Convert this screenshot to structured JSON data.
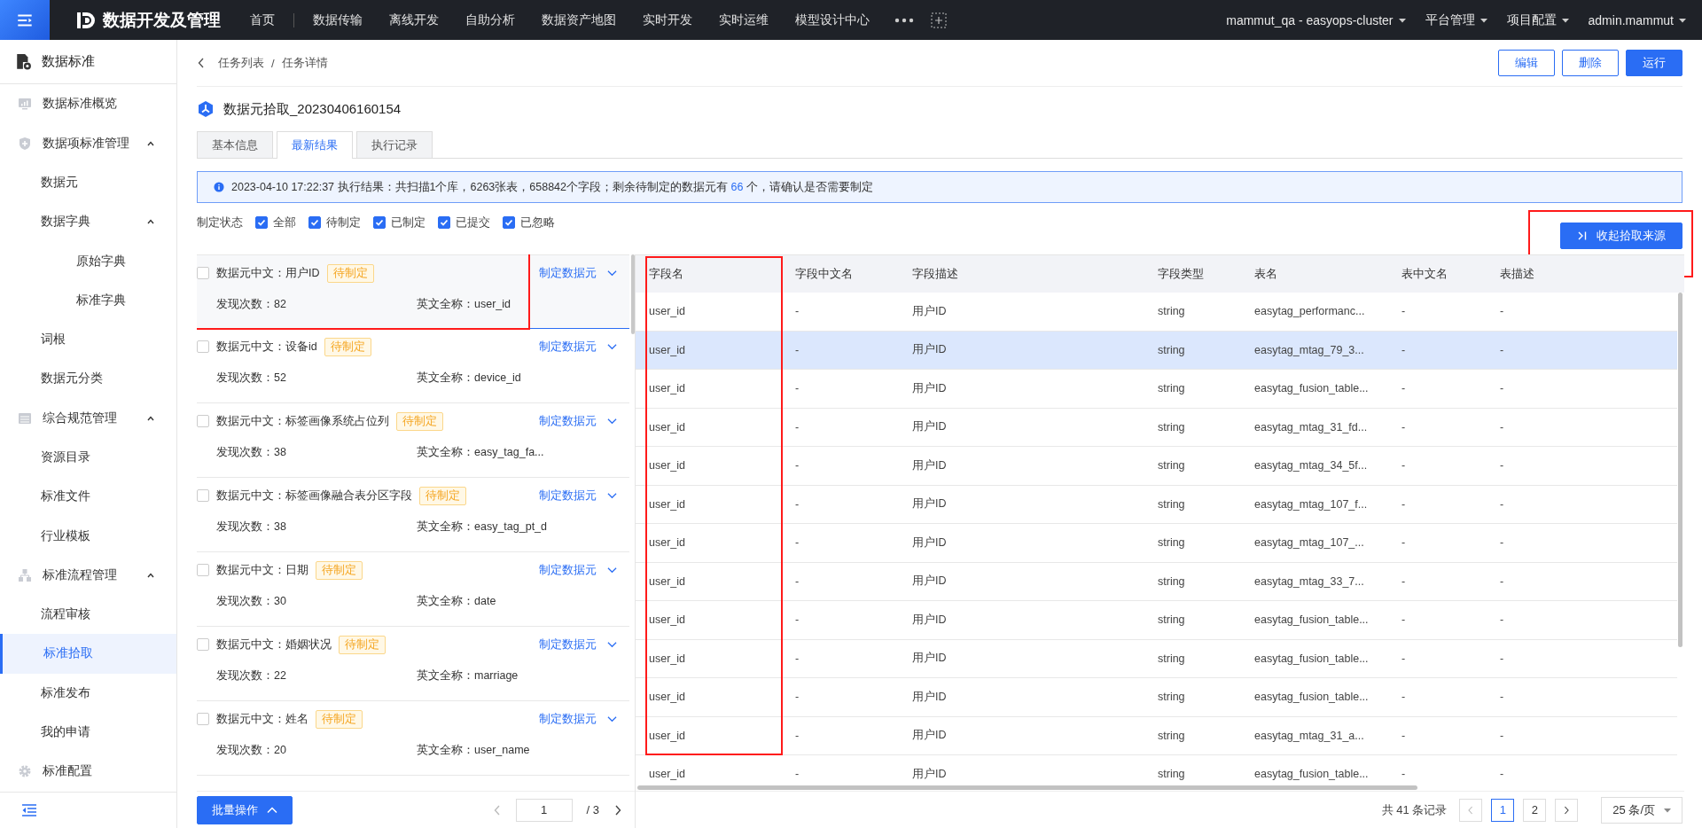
{
  "topbar": {
    "app_title": "数据开发及管理",
    "nav": [
      {
        "label": "首页",
        "selected": false
      },
      {
        "label": "数据传输",
        "selected": false
      },
      {
        "label": "离线开发",
        "selected": false
      },
      {
        "label": "自助分析",
        "selected": false
      },
      {
        "label": "数据资产地图",
        "selected": false
      },
      {
        "label": "实时开发",
        "selected": false
      },
      {
        "label": "实时运维",
        "selected": false
      },
      {
        "label": "模型设计中心",
        "selected": false
      }
    ],
    "menus": [
      "mammut_qa - easyops-cluster",
      "平台管理",
      "项目配置",
      "admin.mammut"
    ]
  },
  "sidebar": {
    "title": "数据标准",
    "items": [
      {
        "label": "数据标准概览",
        "selected": false
      },
      {
        "label": "数据项标准管理",
        "expanded": true,
        "children": [
          {
            "label": "数据元",
            "selected": false
          },
          {
            "label": "数据字典",
            "expanded": true,
            "children": [
              {
                "label": "原始字典",
                "selected": false
              },
              {
                "label": "标准字典",
                "selected": false
              }
            ]
          },
          {
            "label": "词根",
            "selected": false
          },
          {
            "label": "数据元分类",
            "selected": false
          }
        ]
      },
      {
        "label": "综合规范管理",
        "expanded": true,
        "children": [
          {
            "label": "资源目录",
            "selected": false
          },
          {
            "label": "标准文件",
            "selected": false
          },
          {
            "label": "行业模板",
            "selected": false
          }
        ]
      },
      {
        "label": "标准流程管理",
        "expanded": true,
        "children": [
          {
            "label": "流程审核",
            "selected": false
          },
          {
            "label": "标准拾取",
            "selected": true
          },
          {
            "label": "标准发布",
            "selected": false
          },
          {
            "label": "我的申请",
            "selected": false
          }
        ]
      },
      {
        "label": "标准配置",
        "selected": false
      }
    ]
  },
  "breadcrumb": {
    "items": [
      "任务列表",
      "任务详情"
    ],
    "separator": "/"
  },
  "actions": [
    {
      "label": "编辑",
      "kind": "outline"
    },
    {
      "label": "删除",
      "kind": "outline"
    },
    {
      "label": "运行",
      "kind": "primary"
    }
  ],
  "task_title": "数据元拾取_20230406160154",
  "tabs": [
    {
      "label": "基本信息",
      "selected": false
    },
    {
      "label": "最新结果",
      "selected": true
    },
    {
      "label": "执行记录",
      "selected": false
    }
  ],
  "alert": {
    "text_before": "2023-04-10 17:22:37 执行结果：共扫描1个库，6263张表，658842个字段；剩余待制定的数据元有",
    "count": "66",
    "text_after": "个，请确认是否需要制定"
  },
  "filter": {
    "label": "制定状态",
    "options": [
      {
        "label": "全部",
        "checked": true
      },
      {
        "label": "待制定",
        "checked": true
      },
      {
        "label": "已制定",
        "checked": true
      },
      {
        "label": "已提交",
        "checked": true
      },
      {
        "label": "已忽略",
        "checked": true
      }
    ]
  },
  "collapse_button": {
    "label": "收起拾取来源",
    "highlighted": true
  },
  "elements": [
    {
      "name": "数据元中文：用户ID",
      "tag": "待制定",
      "action": "制定数据元",
      "count": "发现次数：82",
      "english": "英文全称：user_id",
      "checked": false,
      "selected": true,
      "highlighted": true
    },
    {
      "name": "数据元中文：设备id",
      "tag": "待制定",
      "action": "制定数据元",
      "count": "发现次数：52",
      "english": "英文全称：device_id",
      "checked": false,
      "selected": false,
      "highlighted": false
    },
    {
      "name": "数据元中文：标签画像系统占位列",
      "tag": "待制定",
      "action": "制定数据元",
      "count": "发现次数：38",
      "english": "英文全称：easy_tag_fa...",
      "checked": false,
      "selected": false,
      "highlighted": false
    },
    {
      "name": "数据元中文：标签画像融合表分区字段",
      "tag": "待制定",
      "action": "制定数据元",
      "count": "发现次数：38",
      "english": "英文全称：easy_tag_pt_d",
      "checked": false,
      "selected": false,
      "highlighted": false
    },
    {
      "name": "数据元中文：日期",
      "tag": "待制定",
      "action": "制定数据元",
      "count": "发现次数：30",
      "english": "英文全称：date",
      "checked": false,
      "selected": false,
      "highlighted": false
    },
    {
      "name": "数据元中文：婚姻状况",
      "tag": "待制定",
      "action": "制定数据元",
      "count": "发现次数：22",
      "english": "英文全称：marriage",
      "checked": false,
      "selected": false,
      "highlighted": false
    },
    {
      "name": "数据元中文：姓名",
      "tag": "待制定",
      "action": "制定数据元",
      "count": "发现次数：20",
      "english": "英文全称：user_name",
      "checked": false,
      "selected": false,
      "highlighted": false
    }
  ],
  "list_footer": {
    "batch_button": "批量操作",
    "page": "1",
    "total_pages": "/ 3"
  },
  "table": {
    "columns": [
      {
        "label": "字段名",
        "highlighted": true
      },
      {
        "label": "字段中文名",
        "highlighted": false
      },
      {
        "label": "字段描述",
        "highlighted": false
      },
      {
        "label": "字段类型",
        "highlighted": false
      },
      {
        "label": "表名",
        "highlighted": false
      },
      {
        "label": "表中文名",
        "highlighted": false
      },
      {
        "label": "表描述",
        "highlighted": false
      }
    ],
    "rows": [
      {
        "cells": [
          "user_id",
          "-",
          "用户ID",
          "string",
          "easytag_performanc...",
          "-",
          "-"
        ],
        "selected": false
      },
      {
        "cells": [
          "user_id",
          "-",
          "用户ID",
          "string",
          "easytag_mtag_79_3...",
          "-",
          "-"
        ],
        "selected": true
      },
      {
        "cells": [
          "user_id",
          "-",
          "用户ID",
          "string",
          "easytag_fusion_table...",
          "-",
          "-"
        ],
        "selected": false
      },
      {
        "cells": [
          "user_id",
          "-",
          "用户ID",
          "string",
          "easytag_mtag_31_fd...",
          "-",
          "-"
        ],
        "selected": false
      },
      {
        "cells": [
          "user_id",
          "-",
          "用户ID",
          "string",
          "easytag_mtag_34_5f...",
          "-",
          "-"
        ],
        "selected": false
      },
      {
        "cells": [
          "user_id",
          "-",
          "用户ID",
          "string",
          "easytag_mtag_107_f...",
          "-",
          "-"
        ],
        "selected": false
      },
      {
        "cells": [
          "user_id",
          "-",
          "用户ID",
          "string",
          "easytag_mtag_107_...",
          "-",
          "-"
        ],
        "selected": false
      },
      {
        "cells": [
          "user_id",
          "-",
          "用户ID",
          "string",
          "easytag_mtag_33_7...",
          "-",
          "-"
        ],
        "selected": false
      },
      {
        "cells": [
          "user_id",
          "-",
          "用户ID",
          "string",
          "easytag_fusion_table...",
          "-",
          "-"
        ],
        "selected": false
      },
      {
        "cells": [
          "user_id",
          "-",
          "用户ID",
          "string",
          "easytag_fusion_table...",
          "-",
          "-"
        ],
        "selected": false
      },
      {
        "cells": [
          "user_id",
          "-",
          "用户ID",
          "string",
          "easytag_fusion_table...",
          "-",
          "-"
        ],
        "selected": false
      },
      {
        "cells": [
          "user_id",
          "-",
          "用户ID",
          "string",
          "easytag_mtag_31_a...",
          "-",
          "-"
        ],
        "selected": false
      },
      {
        "cells": [
          "user_id",
          "-",
          "用户ID",
          "string",
          "easytag_fusion_table...",
          "-",
          "-"
        ],
        "selected": false
      }
    ]
  },
  "pagination": {
    "total": "共 41 条记录",
    "pages": [
      {
        "label": "1",
        "selected": true
      },
      {
        "label": "2",
        "selected": false
      }
    ],
    "page_size": "25 条/页"
  }
}
